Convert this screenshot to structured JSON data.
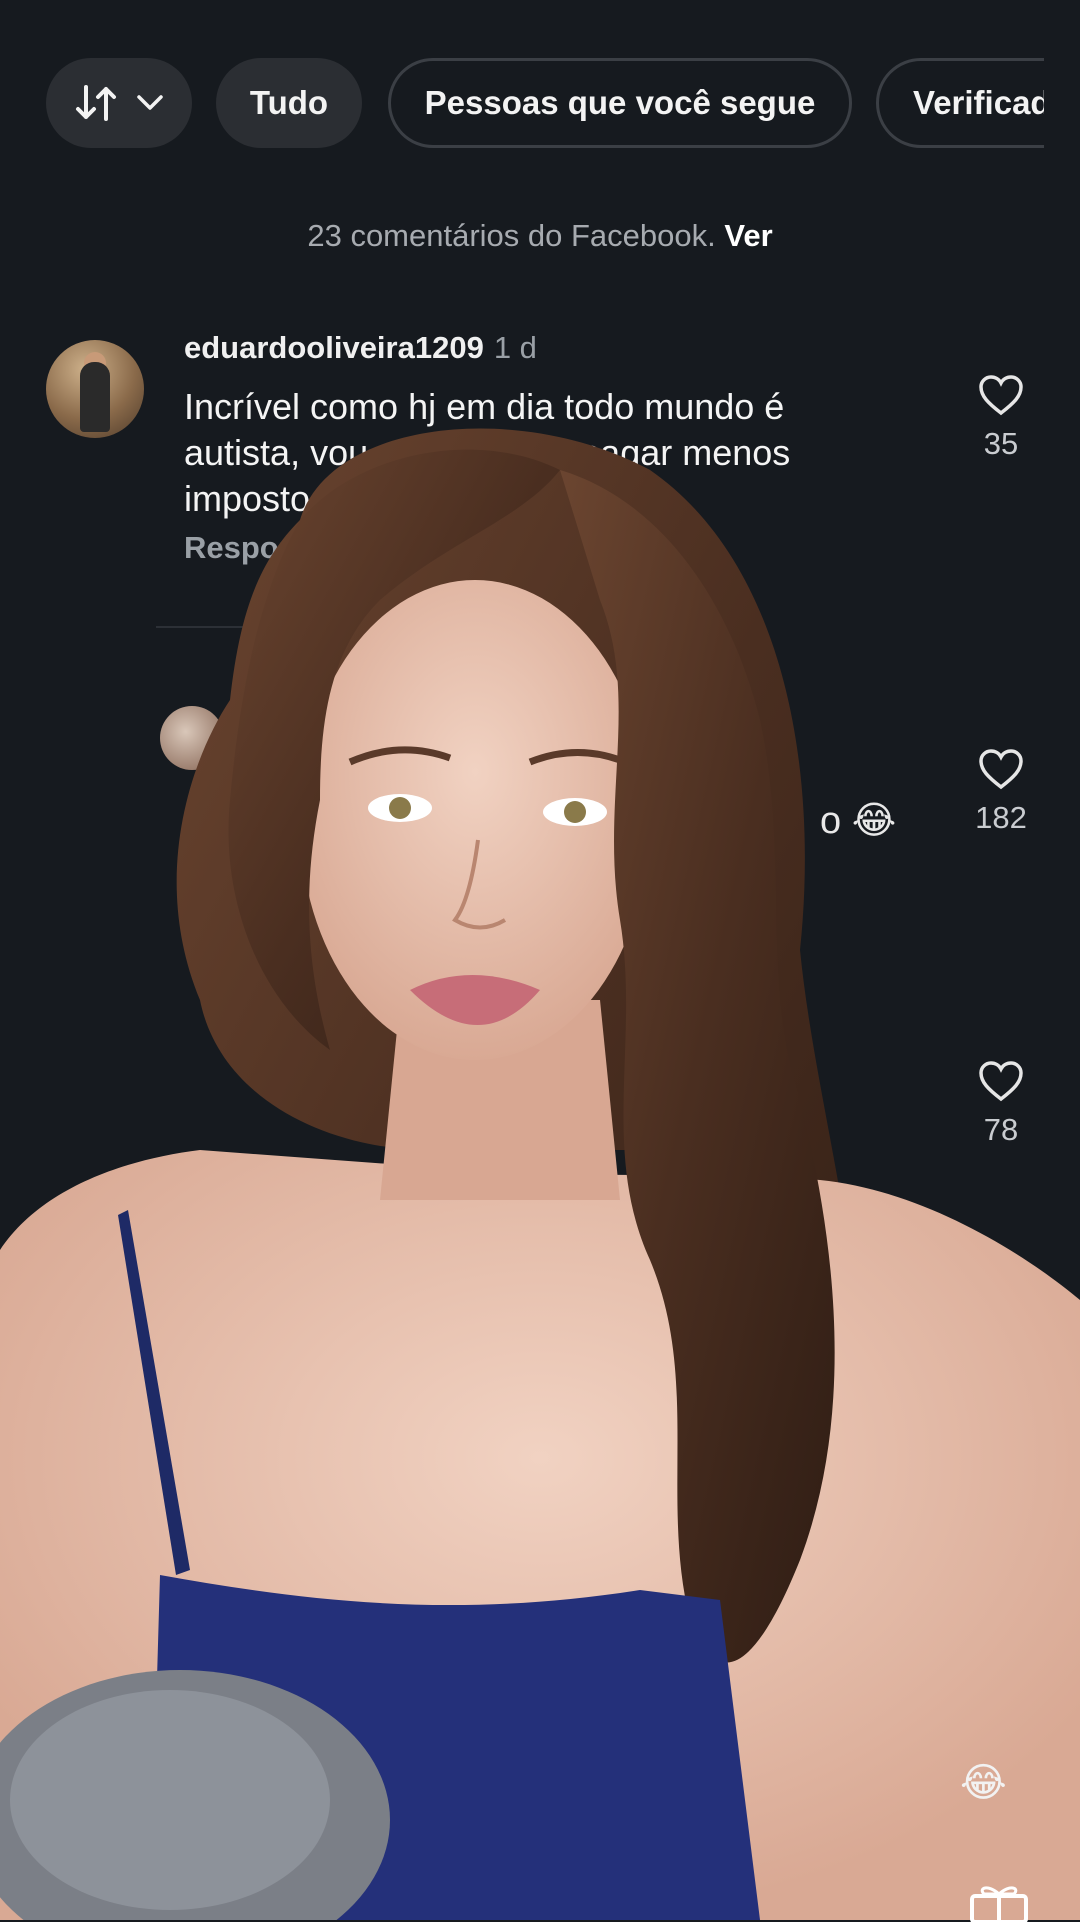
{
  "filters": {
    "sort_icon": "sort-arrows-icon",
    "sort_dropdown_icon": "chevron-down-icon",
    "all_label": "Tudo",
    "following_label": "Pessoas que você segue",
    "verified_label": "Verificad"
  },
  "facebook_note": {
    "text": "23 comentários do Facebook.",
    "action": "Ver"
  },
  "comments": [
    {
      "username": "eduardooliveira1209",
      "time": "1 d",
      "text": "Incrível como hj em dia todo mundo é autista, vou virar um pra pagar menos imposto 😂",
      "reply_label": "Responder",
      "likes": "35"
    },
    {
      "visible_fragment": "o 😂",
      "likes": "182"
    },
    {
      "likes": "78"
    }
  ],
  "icons": {
    "like": "heart-outline-icon",
    "gift": "gift-icon"
  },
  "colors": {
    "background": "#161a1f",
    "chip_fill": "#2b2e33",
    "muted_text": "#9aa0a6"
  }
}
